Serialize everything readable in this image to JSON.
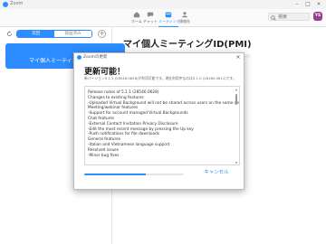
{
  "app": {
    "title": "Zoom"
  },
  "nav": {
    "tabs": [
      {
        "label": "ホーム",
        "icon": "home-icon"
      },
      {
        "label": "チャット",
        "icon": "chat-icon"
      },
      {
        "label": "ミーティング",
        "icon": "meeting-icon",
        "active": true
      },
      {
        "label": "連絡先",
        "icon": "contacts-icon"
      }
    ],
    "search_placeholder": "検索",
    "avatar_initials": "YS"
  },
  "left_panel": {
    "segments": [
      "次回",
      "録画済み"
    ],
    "active_segment": 0,
    "add_label": "+",
    "meeting_card_label": "マイ個人ミーティングID(PMI)"
  },
  "main": {
    "title": "マイ個人ミーティングID(PMI)"
  },
  "dialog": {
    "title": "Zoomの更新",
    "heading": "更新可能！",
    "subtitle": "新バージョン5.1.1 (28546.0628)が利用可能です。現在利用中なのは5.1.0 (28165.0612)です。",
    "notes": [
      "Release notes of 5.1.1 (28546.0628)",
      "Changes to existing features",
      "-Uploaded Virtual Background will not be shared across users on the same device",
      "Meeting/webinar features",
      "-Support for account managed Virtual Backgrounds",
      "Chat features",
      "-External Contact Invitation Privacy Disclosure",
      "-Edit the most recent message by pressing the Up key",
      "-Push notifications for file downloads",
      "General features",
      "-Italian and Vietnamese language support",
      "Resolved issues",
      "-Minor bug fixes"
    ],
    "progress": 0.62,
    "cancel_label": "キャンセル"
  },
  "colors": {
    "accent": "#2d8cff",
    "avatar": "#9b3e8f"
  }
}
